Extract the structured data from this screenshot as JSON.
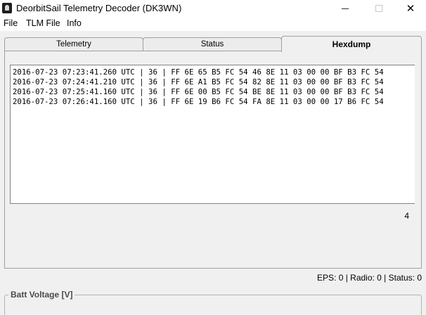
{
  "window": {
    "title": "DeorbitSail Telemetry Decoder (DK3WN)",
    "min_glyph": "",
    "max_glyph": "",
    "close_glyph": "✕"
  },
  "menu": [
    "File",
    "TLM File",
    "Info"
  ],
  "tabs": [
    {
      "label": "Telemetry",
      "active": false
    },
    {
      "label": "Status",
      "active": false
    },
    {
      "label": "Hexdump",
      "active": true
    }
  ],
  "hexdump": {
    "lines": [
      "2016-07-23 07:23:41.260 UTC | 36 | FF 6E 65 B5 FC 54 46 8E 11 03 00 00 BF B3 FC 54",
      "2016-07-23 07:24:41.210 UTC | 36 | FF 6E A1 B5 FC 54 82 8E 11 03 00 00 BF B3 FC 54",
      "2016-07-23 07:25:41.160 UTC | 36 | FF 6E 00 B5 FC 54 BE 8E 11 03 00 00 BF B3 FC 54",
      "2016-07-23 07:26:41.160 UTC | 36 | FF 6E 19 B6 FC 54 FA 8E 11 03 00 00 17 B6 FC 54"
    ],
    "count": "4"
  },
  "status_line": "EPS: 0 | Radio: 0 | Status: 0",
  "group": {
    "batt_voltage_label": "Batt Voltage  [V]"
  },
  "icons": {
    "app": "app-icon",
    "minimize": "minimize-icon",
    "maximize": "maximize-icon",
    "close": "close-icon"
  }
}
